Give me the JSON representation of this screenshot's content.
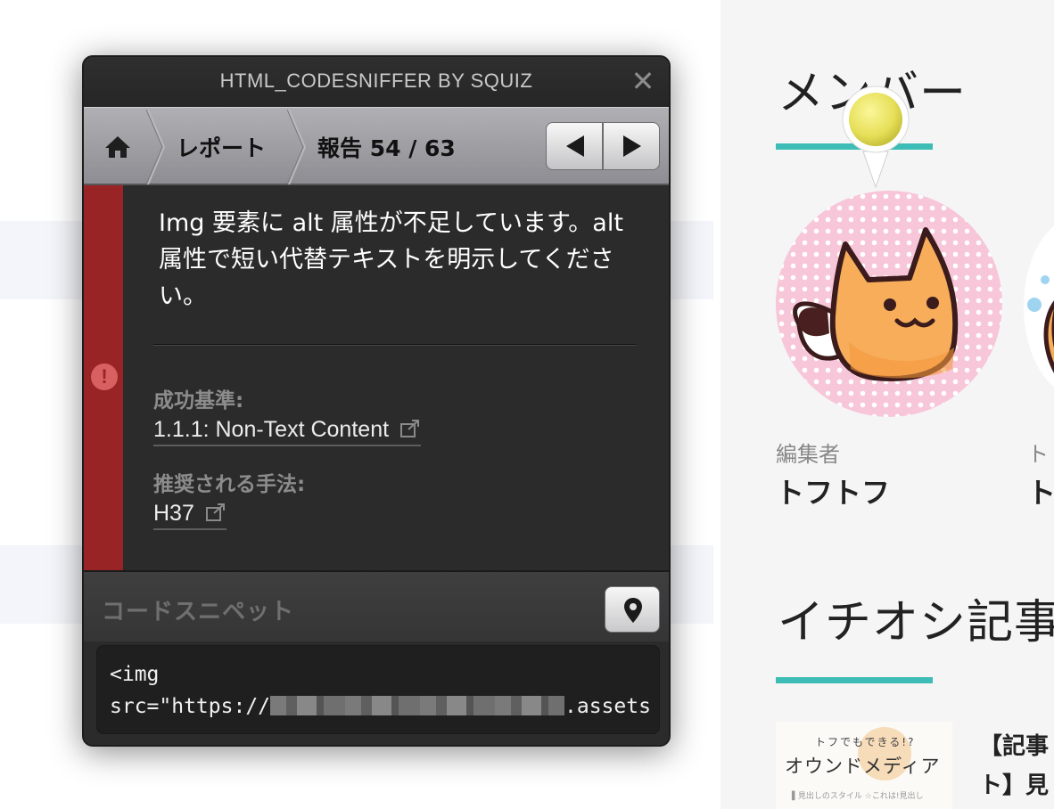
{
  "panel": {
    "title": "HTML_CODESNIFFER BY SQUIZ",
    "close_symbol": "✕",
    "breadcrumb": {
      "report": "レポート",
      "position": "報告 54 / 63"
    },
    "issue": {
      "type_icon": "error-icon",
      "message": "Img 要素に alt 属性が不足しています。alt 属性で短い代替テキストを明示してください。",
      "criteria_label": "成功基準:",
      "criteria_link": "1.1.1: Non-Text Content",
      "techniques_label": "推奨される手法:",
      "technique_link": "H37"
    },
    "snippet": {
      "title": "コードスニペット",
      "line1": "<img",
      "line2_prefix": "src=\"https://",
      "line2_suffix": ".assets"
    },
    "colors": {
      "error": "#992426",
      "panel": "#2b2b2b",
      "accent": "#3dbdb5"
    }
  },
  "page": {
    "members_heading": "メンバー",
    "member": {
      "role": "編集者",
      "name": "トフトフ"
    },
    "member2": {
      "role": "ト",
      "name": "ト"
    },
    "featured_heading": "イチオシ記事",
    "article": {
      "thumb_sub": "トフでもできる!?",
      "thumb_main": "オウンドメディア",
      "thumb_foot": "▌見出しのスタイル ☆これは!見出し",
      "title_line1": "【記事",
      "title_line2": "ト】見"
    }
  }
}
